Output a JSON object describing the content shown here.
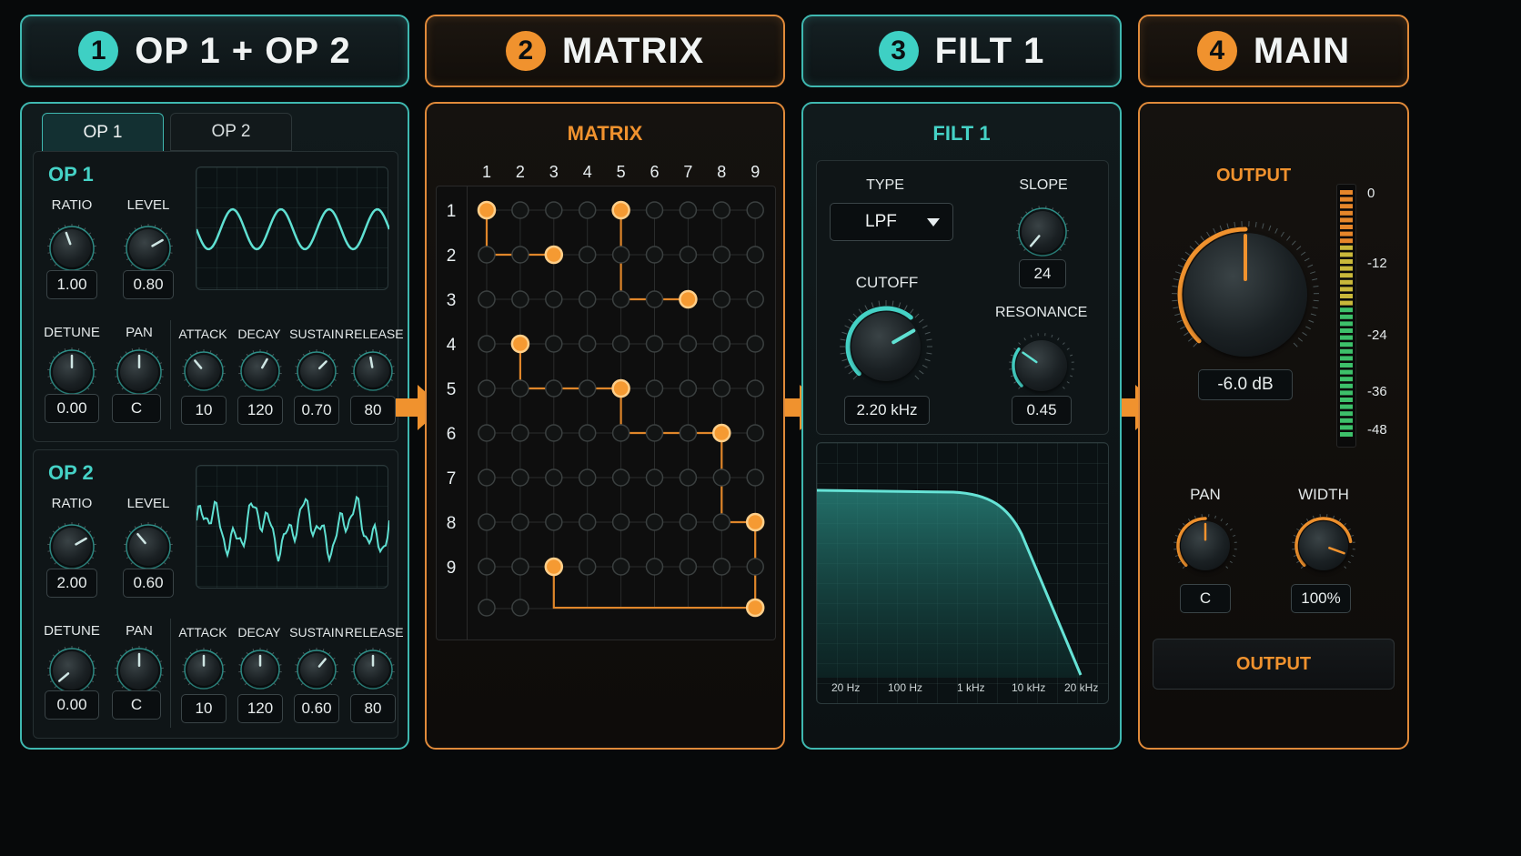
{
  "headers": [
    {
      "number": "1",
      "title": "OP 1 + OP 2"
    },
    {
      "number": "2",
      "title": "MATRIX"
    },
    {
      "number": "3",
      "title": "FILT 1"
    },
    {
      "number": "4",
      "title": "MAIN"
    }
  ],
  "op_panel": {
    "tabs": [
      "OP 1",
      "OP 2"
    ],
    "active_tab": "OP 1",
    "op1": {
      "title": "OP 1",
      "ratio": {
        "label": "RATIO",
        "value": "1.00"
      },
      "level": {
        "label": "LEVEL",
        "value": "0.80"
      },
      "detune": {
        "label": "DETUNE",
        "value": "0.00"
      },
      "pan": {
        "label": "PAN",
        "value": "C"
      },
      "attack": {
        "label": "ATTACK",
        "value": "10"
      },
      "decay": {
        "label": "DECAY",
        "value": "120"
      },
      "sustain": {
        "label": "SUSTAIN",
        "value": "0.70"
      },
      "release": {
        "label": "RELEASE",
        "value": "80"
      },
      "waveform": "sine"
    },
    "op2": {
      "title": "OP 2",
      "ratio": {
        "label": "RATIO",
        "value": "2.00"
      },
      "level": {
        "label": "LEVEL",
        "value": "0.60"
      },
      "detune": {
        "label": "DETUNE",
        "value": "0.00"
      },
      "pan": {
        "label": "PAN",
        "value": "C"
      },
      "attack": {
        "label": "ATTACK",
        "value": "10"
      },
      "decay": {
        "label": "DECAY",
        "value": "120"
      },
      "sustain": {
        "label": "SUSTAIN",
        "value": "0.60"
      },
      "release": {
        "label": "RELEASE",
        "value": "80"
      },
      "waveform": "complex"
    }
  },
  "matrix": {
    "title": "MATRIX",
    "columns": [
      "1",
      "2",
      "3",
      "4",
      "5",
      "6",
      "7",
      "8",
      "9"
    ],
    "rows": [
      "1",
      "2",
      "3",
      "4",
      "5",
      "6",
      "7",
      "8",
      "9"
    ],
    "active_nodes": [
      {
        "row": 1,
        "col": 1
      },
      {
        "row": 1,
        "col": 5
      },
      {
        "row": 2,
        "col": 3
      },
      {
        "row": 3,
        "col": 7
      },
      {
        "row": 4,
        "col": 2
      },
      {
        "row": 5,
        "col": 5
      },
      {
        "row": 6,
        "col": 8
      },
      {
        "row": 8,
        "col": 9
      },
      {
        "row": 9,
        "col": 3
      }
    ]
  },
  "filter": {
    "title": "FILT 1",
    "type": {
      "label": "TYPE",
      "value": "LPF"
    },
    "slope": {
      "label": "SLOPE",
      "value": "24"
    },
    "cutoff": {
      "label": "CUTOFF",
      "value": "2.20 kHz"
    },
    "resonance": {
      "label": "RESONANCE",
      "value": "0.45"
    },
    "freq_labels": [
      "20 Hz",
      "100 Hz",
      "1 kHz",
      "10 kHz",
      "20 kHz"
    ]
  },
  "main": {
    "output_label": "OUTPUT",
    "output_value": "-6.0 dB",
    "meter_labels": [
      "0",
      "-12",
      "-24",
      "-36",
      "-48"
    ],
    "pan": {
      "label": "PAN",
      "value": "C"
    },
    "width": {
      "label": "WIDTH",
      "value": "100%"
    },
    "output_button": "OUTPUT"
  },
  "colors": {
    "teal": "#3fb8b0",
    "orange": "#f0922e",
    "bg": "#07090a"
  }
}
